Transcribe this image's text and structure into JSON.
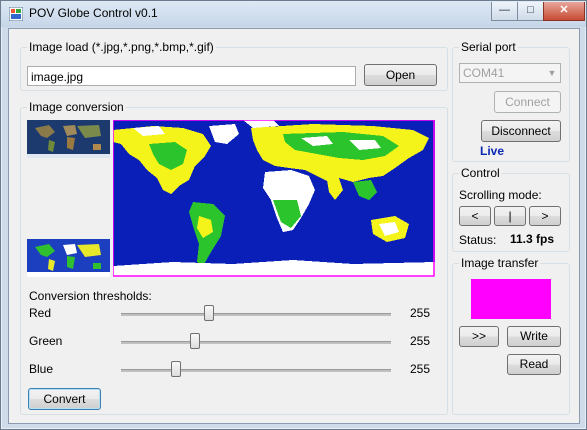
{
  "window": {
    "title": "POV Globe Control v0.1",
    "minimize": "—",
    "maximize": "□",
    "close": "✕"
  },
  "image_load": {
    "legend": "Image load (*.jpg,*.png,*.bmp,*.gif)",
    "filename_value": "image.jpg",
    "open_label": "Open"
  },
  "image_conversion": {
    "legend": "Image conversion",
    "thresholds_label": "Conversion thresholds:",
    "sliders": [
      {
        "label": "Red",
        "value": "255",
        "position": 0.31
      },
      {
        "label": "Green",
        "value": "255",
        "position": 0.26
      },
      {
        "label": "Blue",
        "value": "255",
        "position": 0.2
      }
    ],
    "convert_label": "Convert"
  },
  "serial_port": {
    "legend": "Serial port",
    "port_value": "COM41",
    "connect_label": "Connect",
    "disconnect_label": "Disconnect",
    "status": "Live",
    "status_color": "#0a28b4"
  },
  "control": {
    "legend": "Control",
    "scrolling_label": "Scrolling mode:",
    "buttons": [
      "<",
      "|",
      ">"
    ],
    "status_label": "Status:",
    "status_value": "11.3 fps"
  },
  "image_transfer": {
    "legend": "Image transfer",
    "preview_color": "#ff00ff",
    "forward_label": ">>",
    "write_label": "Write",
    "read_label": "Read"
  }
}
